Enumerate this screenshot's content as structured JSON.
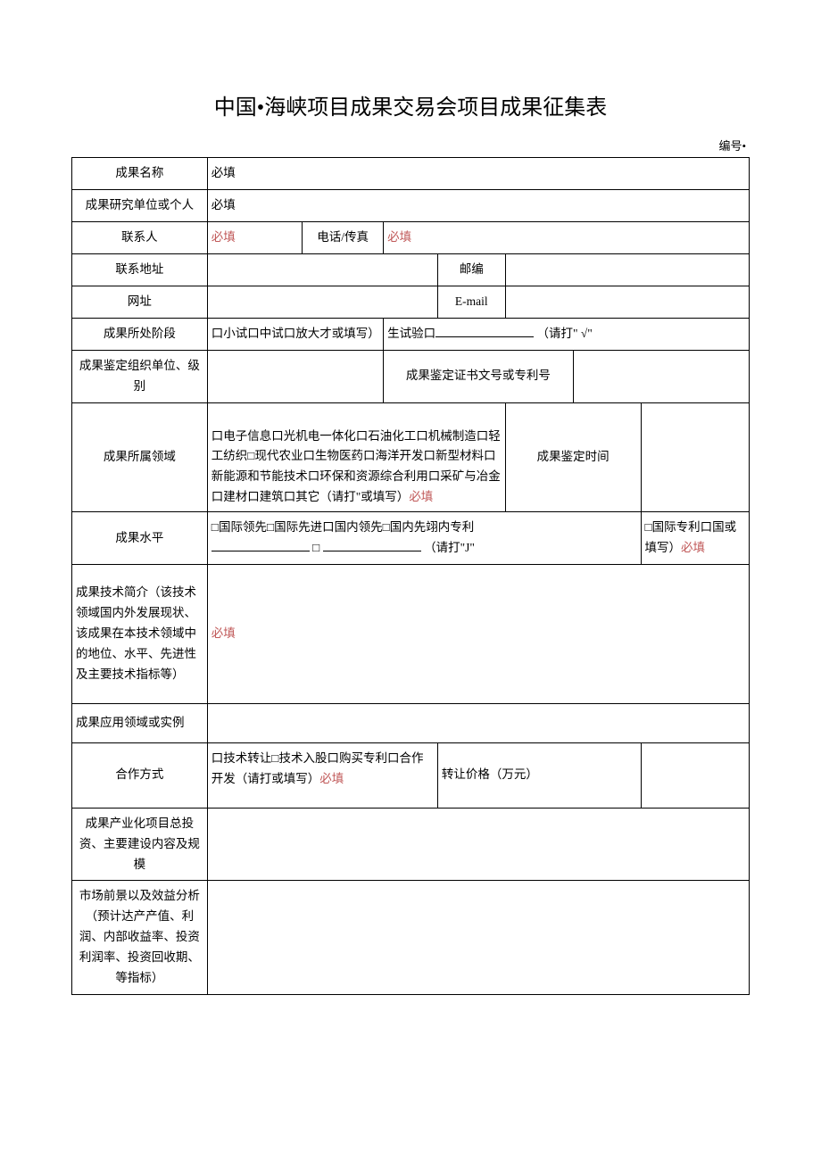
{
  "title": "中国•海峡项目成果交易会项目成果征集表",
  "serial_label": "编号•",
  "labels": {
    "name": "成果名称",
    "org": "成果研究单位或个人",
    "contact": "联系人",
    "phone": "电话/传真",
    "address": "联系地址",
    "postcode": "邮编",
    "website": "网址",
    "email": "E-mail",
    "stage": "成果所处阶段",
    "appraisal_org": "成果鉴定组织单位、级别",
    "cert_no": "成果鉴定证书文号或专利号",
    "field": "成果所属领域",
    "appraisal_time": "成果鉴定时间",
    "level": "成果水平",
    "summary": "成果技术简介（该技术领域国内外发展现状、该成果在本技术领域中的地位、水平、先进性及主要技术指标等）",
    "application": "成果应用领域或实例",
    "coop": "合作方式",
    "transfer_price": "转让价格（万元）",
    "investment": "成果产业化项目总投资、主要建设内容及规模",
    "market": "市场前景以及效益分析（预计达产产值、利润、内部收益率、投资利润率、投资回收期、等指标）"
  },
  "values": {
    "required": "必填",
    "stage_prefix": "口小试口中试口放大才或填写）",
    "stage_suffix1": "生试验口",
    "stage_suffix2": "（请打\" √\"",
    "field_text_1": "口电子信息口光机电一体化口石油化工口机械制造口轻工纺织□现代农业口生物医药口海洋开发口新型材料口新能源和节能技术口环保和资源综合利用口采矿与冶金口建材口建筑口其它（请打\"或填写）",
    "level_text_1": "□国际领先□国际先进口国内领先□国内先翊内专利",
    "level_text_2": "□",
    "level_text_3": "（请打\"J\"",
    "level_text_4": "□国际专利口国或填写）",
    "coop_text": "口技术转让□技术入股口购买专利口合作开发（请打或填写）"
  }
}
